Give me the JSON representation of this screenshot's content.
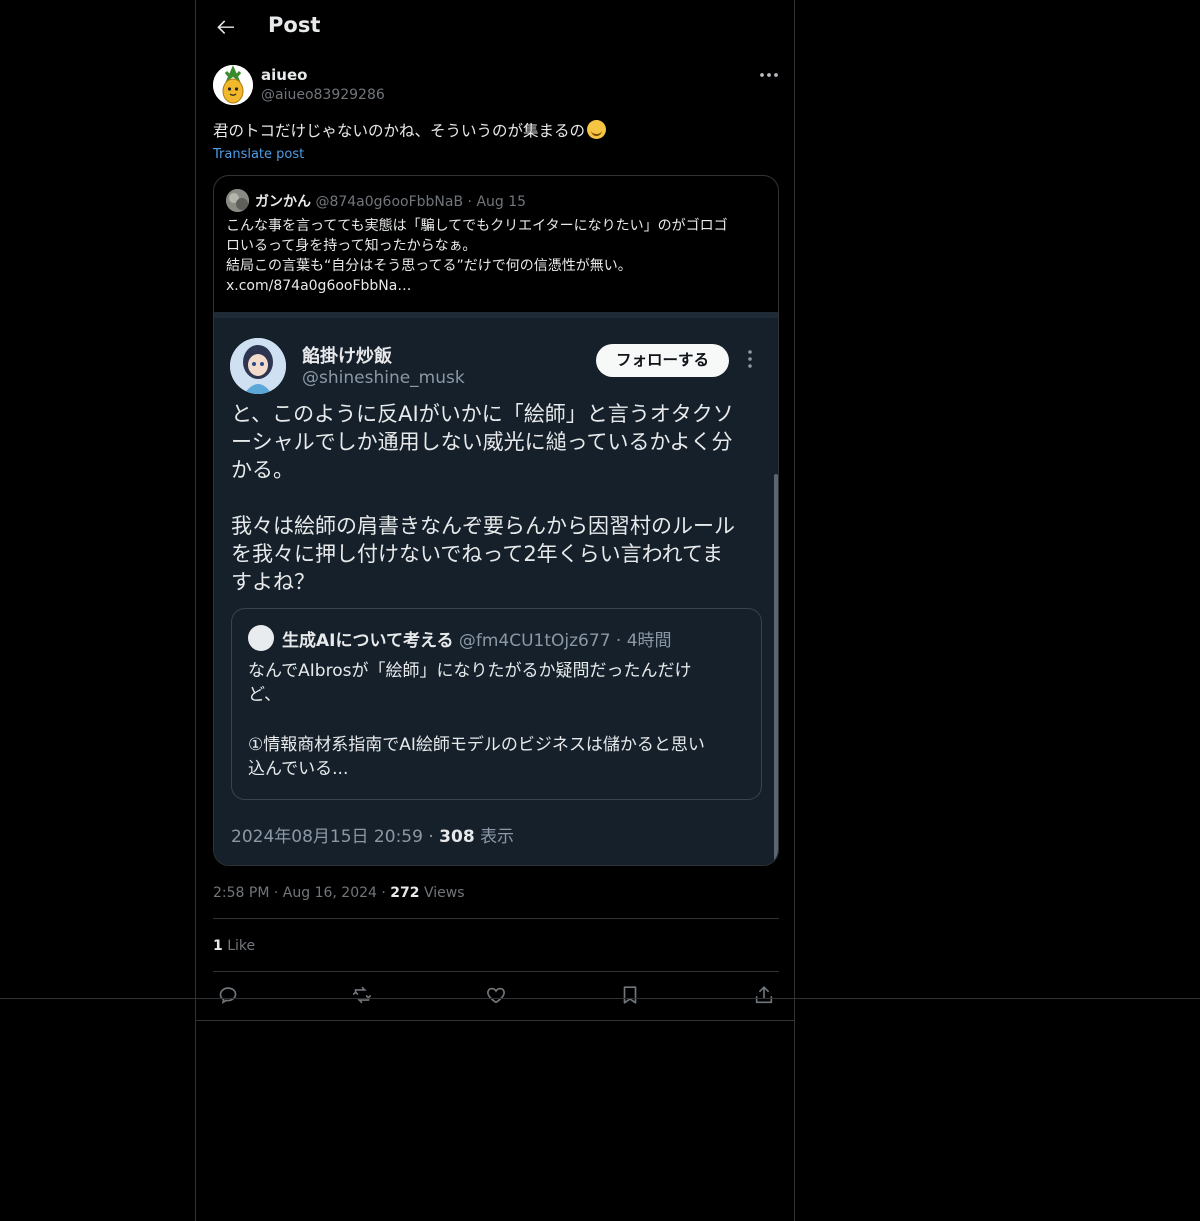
{
  "header": {
    "title": "Post",
    "back_icon": "arrow-left-icon"
  },
  "post": {
    "author_name": "aiueo",
    "author_handle": "@aiueo83929286",
    "text": "君のトコだけじゃないのかね、そういうのが集まるの",
    "emoji": "face-with-hand-over-mouth-emoji",
    "translate_label": "Translate post",
    "time": "2:58 PM",
    "date": "Aug 16, 2024",
    "views_count": "272",
    "views_label": "Views",
    "likes_count": "1",
    "likes_label": "Like",
    "sep": "·"
  },
  "quote": {
    "name": "ガンかん",
    "handle": "@874a0g6ooFbbNaB",
    "date": "Aug 15",
    "lines": [
      "こんな事を言ってても実態は「騙してでもクリエイターになりたい」のがゴロゴ",
      "ロいるって身を持って知ったからなぁ。",
      "結局この言葉も“自分はそう思ってる”だけで何の信憑性が無い。",
      "x.com/874a0g6ooFbbNa…"
    ]
  },
  "screenshot": {
    "name": "餡掛け炒飯",
    "handle": "@shineshine_musk",
    "follow_label": "フォローする",
    "lines_1": [
      "と、このように反AIがいかに「絵師」と言うオタクソ",
      "ーシャルでしか通用しない威光に縋っているかよく分",
      "かる。"
    ],
    "lines_2": [
      "我々は絵師の肩書きなんぞ要らんから因習村のルール",
      "を我々に押し付けないでねって2年くらい言われてま",
      "すよね？"
    ],
    "inner_quote": {
      "name": "生成AIについて考える",
      "handle": "@fm4CU1tOjz677",
      "time": "4時間",
      "lines_1": [
        "なんでAIbrosが「絵師」になりたがるか疑問だったんだけ",
        "ど、"
      ],
      "lines_2": [
        "①情報商材系指南でAI絵師モデルのビジネスは儲かると思い",
        "込んでいる..."
      ]
    },
    "datetime": "2024年08月15日 20:59",
    "views_count": "308",
    "views_label": "表示"
  },
  "actions": {
    "reply_icon": "reply-icon",
    "repost_icon": "repost-icon",
    "like_icon": "heart-icon",
    "bookmark_icon": "bookmark-icon",
    "share_icon": "share-icon"
  },
  "colors": {
    "background": "#000000",
    "border": "#2f3336",
    "link": "#4e9ee8",
    "muted": "#71767b",
    "screenshot_bg": "#15202b"
  }
}
